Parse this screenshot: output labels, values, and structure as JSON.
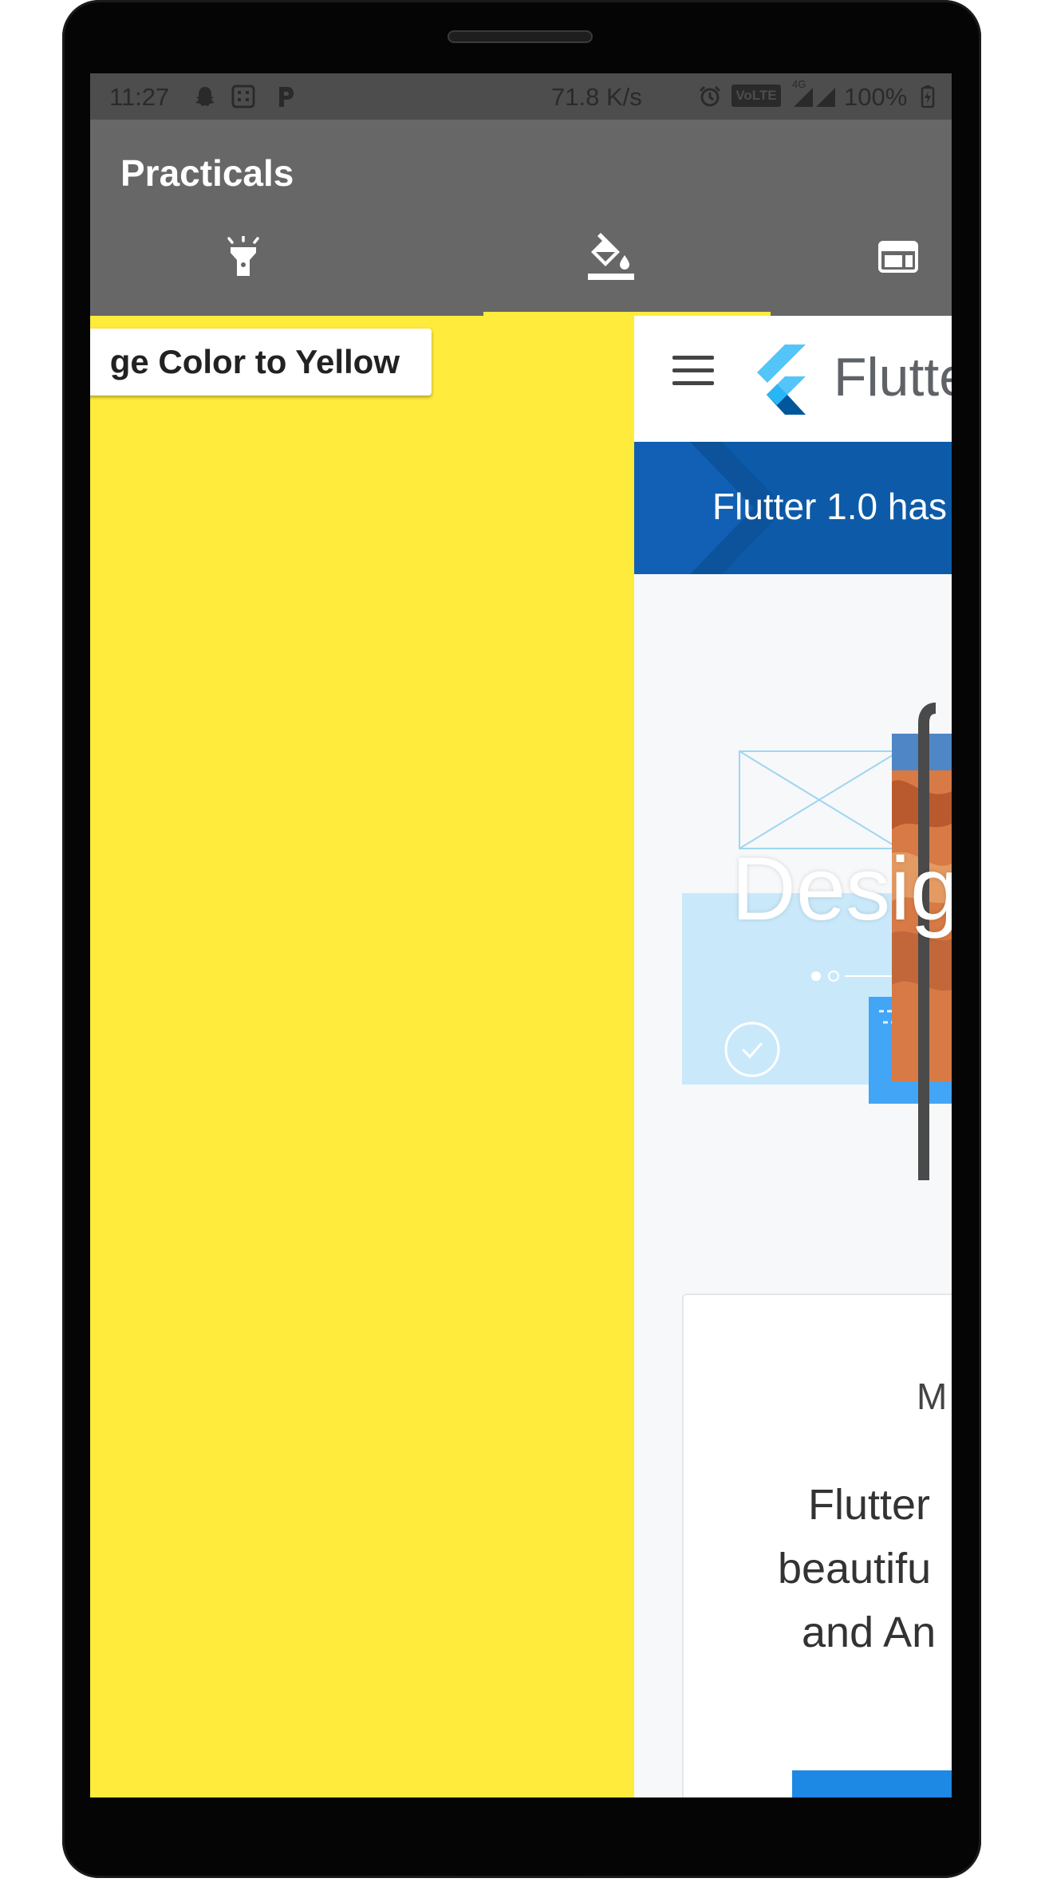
{
  "status_bar": {
    "time": "11:27",
    "network_speed": "71.8 K/s",
    "volte_badge": "VoLTE",
    "network_type": "4G",
    "battery": "100%"
  },
  "app_bar": {
    "title": "Practicals",
    "tabs": [
      {
        "icon": "flashlight-icon",
        "selected": false
      },
      {
        "icon": "paint-bucket-icon",
        "selected": true
      },
      {
        "icon": "web-window-icon",
        "selected": false
      }
    ],
    "indicator_color": "#ffeb3b"
  },
  "yellow_tab": {
    "background": "#ffeb3b",
    "button_label": "ge Color to Yellow"
  },
  "web_tab": {
    "brand": "Flutte",
    "banner_text": "Flutter 1.0 has",
    "hero_text": "Desig",
    "card": {
      "heading": "M",
      "line1": "Flutter",
      "line2": "beautifu",
      "line3": "and An"
    },
    "accent": "#0d5ba8"
  }
}
